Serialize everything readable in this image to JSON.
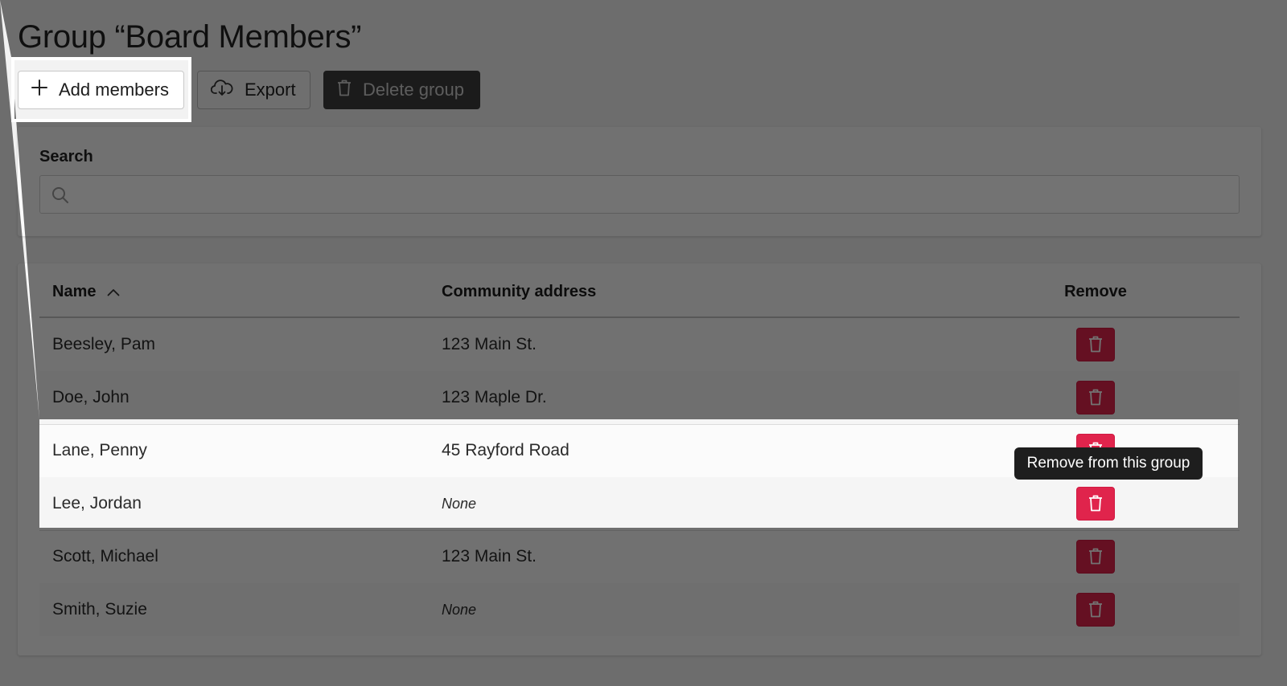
{
  "page": {
    "title": "Group “Board Members”"
  },
  "toolbar": {
    "add_members_label": "Add members",
    "export_label": "Export",
    "delete_group_label": "Delete group"
  },
  "search": {
    "label": "Search",
    "value": "",
    "placeholder": ""
  },
  "table": {
    "columns": {
      "name": "Name",
      "address": "Community address",
      "remove": "Remove"
    },
    "sort": {
      "column": "Name",
      "direction": "ascending"
    },
    "rows": [
      {
        "name": "Beesley, Pam",
        "address": "123 Main St."
      },
      {
        "name": "Doe, John",
        "address": "123 Maple Dr."
      },
      {
        "name": "Lane, Penny",
        "address": "45 Rayford Road"
      },
      {
        "name": "Lee, Jordan",
        "address": "None"
      },
      {
        "name": "Scott, Michael",
        "address": "123 Main St."
      },
      {
        "name": "Smith, Suzie",
        "address": "None"
      }
    ]
  },
  "tooltip": {
    "text": "Remove from this group"
  },
  "icons": {
    "add": "plus-icon",
    "export": "cloud-download-icon",
    "delete_group": "trash-icon",
    "search": "search-icon",
    "sort": "chevron-up-icon",
    "remove_row": "trash-icon"
  },
  "colors": {
    "danger": "#e0244c",
    "dim_overlay": "#000000",
    "highlight": "#ffffff",
    "tooltip_bg": "#1e1e1e"
  }
}
